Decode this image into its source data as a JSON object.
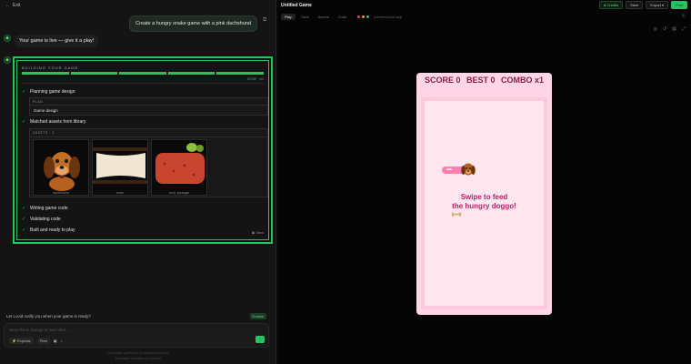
{
  "left": {
    "topbar": {
      "back_label": "Exit"
    },
    "user_message": "Create a hungry snake game with a pink dachshund",
    "ai_message": "Your game is live — give it a play!",
    "building": {
      "title": "BUILDING YOUR GAME",
      "progress_text": "DONE · 4/4",
      "progress_steps": 5,
      "steps": [
        "Planning game design",
        "Matched assets from library",
        "Writing game code",
        "Validating code",
        "Built and ready to play"
      ],
      "plan": {
        "header": "PLAN",
        "value": "Game design"
      },
      "assets": {
        "header": "ASSETS · 3",
        "items": [
          {
            "caption": "dachshund"
          },
          {
            "caption": "bone"
          },
          {
            "caption": "food_sausage"
          }
        ]
      },
      "view_label": "View"
    },
    "notify": {
      "text": "Let Lovid notify you when your game is ready?",
      "button": "Enable"
    },
    "composer": {
      "placeholder": "Describe a change or new idea...",
      "mode": "Express",
      "chip": "Free",
      "send_icon": "arrow-up-icon"
    },
    "footnote": {
      "line1": "Generated games are AI-assisted previews",
      "line2": "Messages are saved to this chat"
    }
  },
  "right": {
    "title": "Untitled Game",
    "actions": {
      "credits": "Credits",
      "save": "Save",
      "export": "Export",
      "post": "Post"
    },
    "tabs": [
      "Play",
      "Tune",
      "Assets",
      "Code"
    ],
    "url": "preview.lovid.app",
    "game": {
      "score_label": "SCORE 0",
      "best_label": "BEST 0",
      "combo_label": "COMBO x1",
      "prompt_line1": "Swipe to feed",
      "prompt_line2": "the hungry doggo!",
      "colors": {
        "board": "#ffd6e7",
        "arena": "#ffe6ef",
        "hud_text": "#8b1f45",
        "prompt": "#b0246a",
        "snake": "#ff7fb0"
      }
    }
  },
  "colors": {
    "accent": "#22c55e",
    "panel": "#141414"
  }
}
